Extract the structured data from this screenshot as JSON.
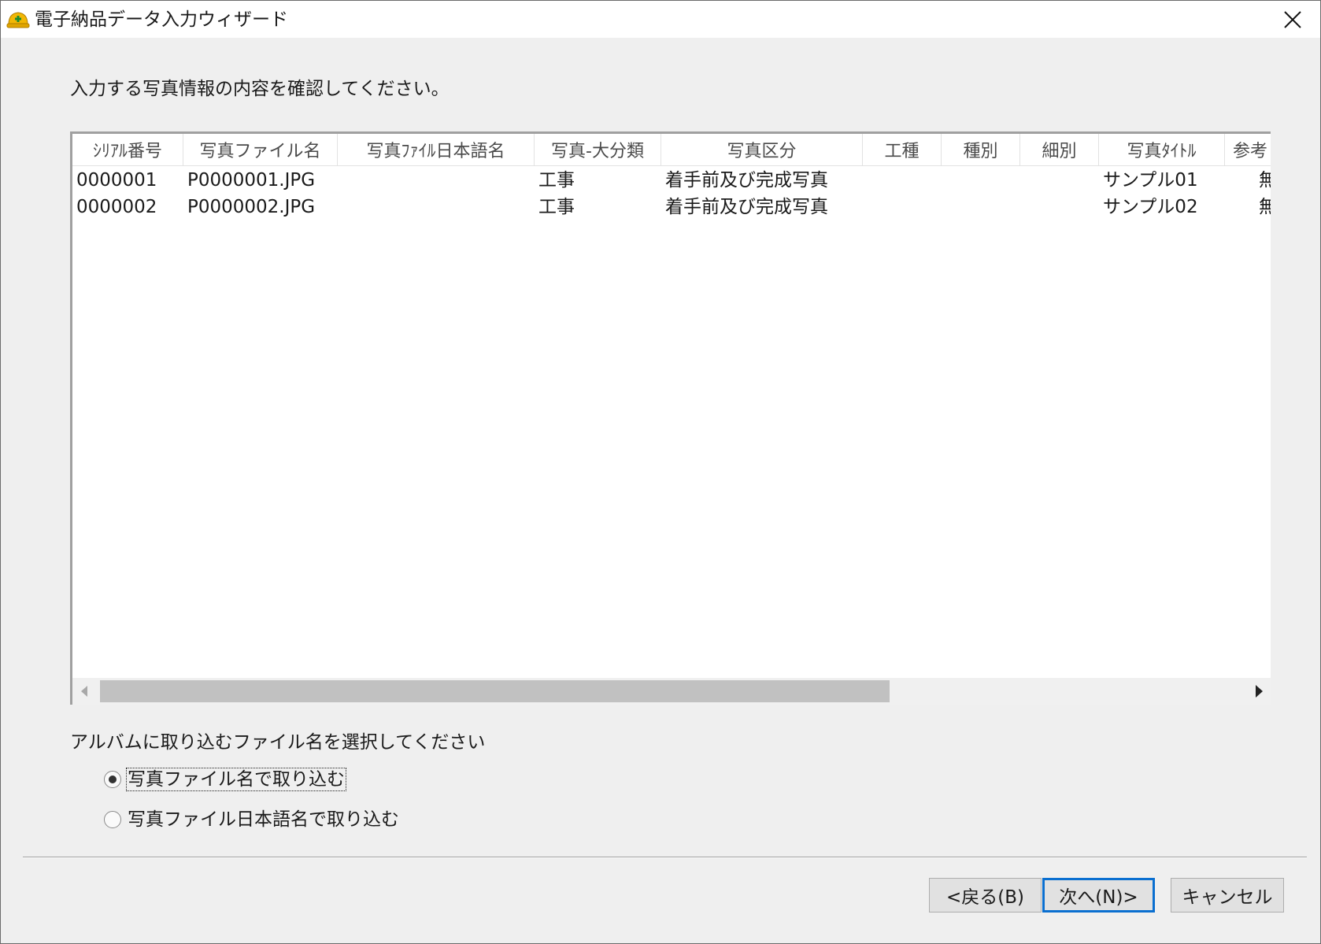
{
  "window": {
    "title": "電子納品データ入力ウィザード"
  },
  "instruction": "入力する写真情報の内容を確認してください。",
  "table": {
    "columns": [
      "ｼﾘｱﾙ番号",
      "写真ファイル名",
      "写真ﾌｧｲﾙ日本語名",
      "写真-大分類",
      "写真区分",
      "工種",
      "種別",
      "細別",
      "写真ﾀｲﾄﾙ",
      "参考"
    ],
    "rows": [
      [
        "0000001",
        "P0000001.JPG",
        "",
        "工事",
        "着手前及び完成写真",
        "",
        "",
        "",
        "サンプル01",
        "無"
      ],
      [
        "0000002",
        "P0000002.JPG",
        "",
        "工事",
        "着手前及び完成写真",
        "",
        "",
        "",
        "サンプル02",
        "無"
      ]
    ]
  },
  "file_select": {
    "label": "アルバムに取り込むファイル名を選択してください",
    "options": [
      {
        "label": "写真ファイル名で取り込む",
        "checked": true
      },
      {
        "label": "写真ファイル日本語名で取り込む",
        "checked": false
      }
    ]
  },
  "buttons": {
    "back": "<戻る(B)",
    "next": "次へ(N)>",
    "cancel": "キャンセル"
  }
}
